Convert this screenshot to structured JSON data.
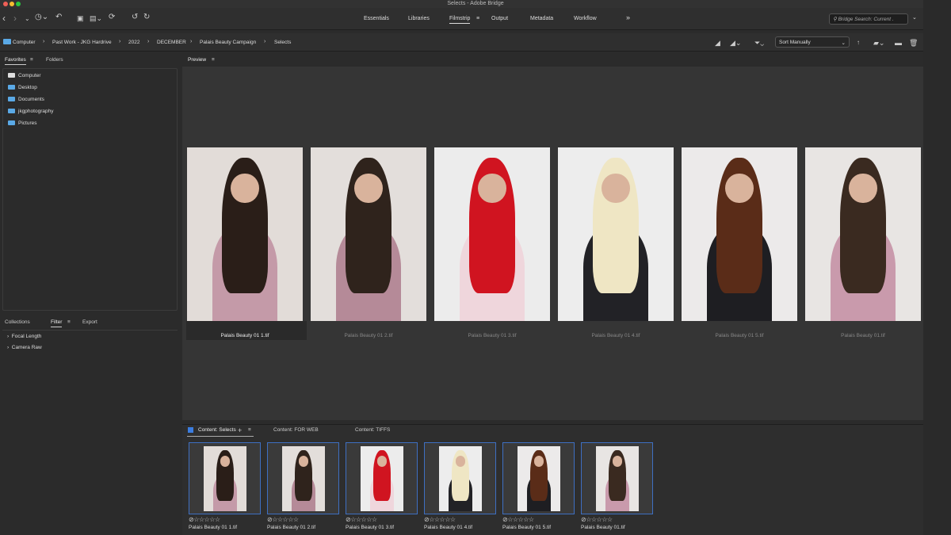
{
  "window": {
    "title": "Selects - Adobe Bridge"
  },
  "workspaces": [
    "Essentials",
    "Libraries",
    "Filmstrip",
    "Output",
    "Metadata",
    "Workflow"
  ],
  "active_workspace": "Filmstrip",
  "search": {
    "placeholder": "Bridge Search: Current ."
  },
  "breadcrumb": [
    "Computer",
    "Past Work - JKG Hardrive",
    "2022",
    "DECEMBER",
    "Palais Beauty Campaign",
    "Selects"
  ],
  "sort": {
    "value": "Sort Manually"
  },
  "left": {
    "tabs": [
      "Favorites",
      "Folders"
    ],
    "favorites": [
      "Computer",
      "Desktop",
      "Documents",
      "jkgphotography",
      "Pictures"
    ],
    "bottom_tabs": [
      "Collections",
      "Filter",
      "Export"
    ],
    "filters": [
      "Focal Length",
      "Camera Raw"
    ]
  },
  "preview": {
    "title": "Preview"
  },
  "photos": [
    {
      "name": "Palais Beauty 01 1.tif",
      "bg": "#e2dcd8",
      "hair": "#2a1e18",
      "top": "#c49aa8"
    },
    {
      "name": "Palais Beauty 01 2.tif",
      "bg": "#e3dedb",
      "hair": "#2f231c",
      "top": "#b58a98"
    },
    {
      "name": "Palais Beauty 01 3.tif",
      "bg": "#ececec",
      "hair": "#d01420",
      "top": "#efd6dc"
    },
    {
      "name": "Palais Beauty 01 4.tif",
      "bg": "#ededed",
      "hair": "#efe6c4",
      "top": "#222226"
    },
    {
      "name": "Palais Beauty 01 5.tif",
      "bg": "#eceaea",
      "hair": "#5a2c18",
      "top": "#1e1e22"
    },
    {
      "name": "Palais Beauty 01.tif",
      "bg": "#e8e5e3",
      "hair": "#3a2a20",
      "top": "#c99aac"
    }
  ],
  "content": {
    "tabs": [
      "Content: Selects",
      "Content: FOR WEB",
      "Content: TIFFS"
    ],
    "rating": "☆☆☆☆☆"
  }
}
